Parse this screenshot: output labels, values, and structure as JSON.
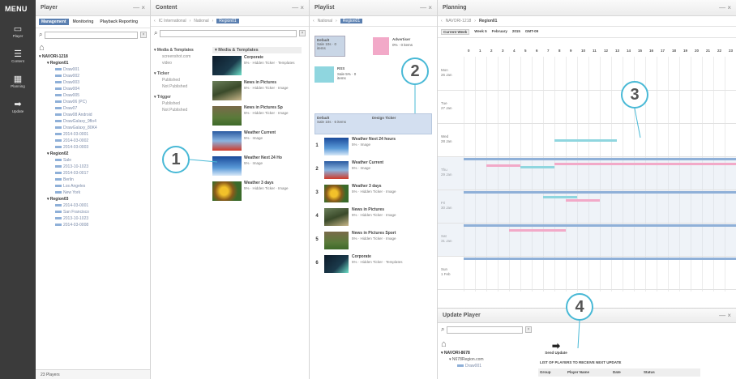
{
  "menu": {
    "title": "MENU",
    "items": [
      {
        "label": "Player",
        "icon": "monitor-icon"
      },
      {
        "label": "Content",
        "icon": "content-icon"
      },
      {
        "label": "Planning",
        "icon": "calendar-icon"
      },
      {
        "label": "Update",
        "icon": "arrow-right-icon"
      }
    ]
  },
  "player_panel": {
    "title": "Player",
    "controls": "— ×",
    "tabs": [
      "Management",
      "Monitoring",
      "Playback Reporting"
    ],
    "search_placeholder": "",
    "tree": {
      "root": "NAVORI-1218",
      "region1": "Region01",
      "region1_items": [
        "Draw001",
        "Draw002",
        "Draw003",
        "Draw004",
        "Draw005",
        "Draw06 (PC)",
        "Draw07",
        "Draw08 Android",
        "DrawGalaxy_9flo4",
        "DrawGalaxy_80K4",
        "2014-03-0001",
        "2014-03-0002",
        "2014-03-0003"
      ],
      "region2": "Region02",
      "region2_items": [
        "Sale",
        "2013-10-1023",
        "2014-03-0017",
        "Berlin",
        "Los Angeles",
        "New York"
      ],
      "region3": "Region03",
      "region3_items": [
        "2014-03-0001",
        "San Francisco",
        "2013-10-1023",
        "2014-03-0008"
      ]
    },
    "footer": "23 Players"
  },
  "content_panel": {
    "title": "Content",
    "controls": "— ×",
    "breadcrumb": [
      "IC International",
      "National",
      "Region01"
    ],
    "tree": {
      "media": "Media & Templates",
      "media_items": [
        "screenshot.com",
        "video"
      ],
      "ticker": "Ticker",
      "ticker_items": [
        "Published",
        "Not Published"
      ],
      "trigger": "Trigger",
      "trigger_items": [
        "Published",
        "Not Published"
      ]
    },
    "list_header": "Media & Templates",
    "items": [
      {
        "title": "Corporate",
        "meta": "5% · Hidden Ticker · Templates"
      },
      {
        "title": "News in Pictures",
        "meta": "5% · Hidden Ticker · Image"
      },
      {
        "title": "News in Pictures Sp",
        "meta": "5% · Hidden Ticker · Image"
      },
      {
        "title": "Weather Current",
        "meta": "5% · Image"
      },
      {
        "title": "Weather Next 24 Ho",
        "meta": "5% · Image"
      },
      {
        "title": "Weather 3 days",
        "meta": "5% · Hidden Ticker · Image"
      }
    ]
  },
  "playlist_panel": {
    "title": "Playlist",
    "controls": "— ×",
    "breadcrumb": [
      "National",
      "Region01"
    ],
    "slots": [
      {
        "label": "Default",
        "meta": "Sale 10s · 0 items"
      },
      {
        "label": "Advertiser",
        "meta": "0% · 0 items"
      },
      {
        "label": "RSS",
        "meta": "Sale 5% · 0 items"
      }
    ],
    "selected": {
      "label": "Default",
      "meta": "Sale 10s · 6 items",
      "extra": "Design Ticker"
    },
    "items": [
      {
        "num": "1",
        "title": "Weather Next 24 hours",
        "meta": "5% · Image"
      },
      {
        "num": "2",
        "title": "Weather Current",
        "meta": "5% · Image"
      },
      {
        "num": "3",
        "title": "Weather 3 days",
        "meta": "5% · Hidden Ticker · Image"
      },
      {
        "num": "4",
        "title": "News in Pictures",
        "meta": "5% · Hidden Ticker · Image"
      },
      {
        "num": "5",
        "title": "News in Pictures Sport",
        "meta": "5% · Hidden Ticker · Image"
      },
      {
        "num": "6",
        "title": "Corporate",
        "meta": "5% · Hidden Ticker · Templates"
      }
    ]
  },
  "planning_panel": {
    "title": "Planning",
    "controls": "— ×",
    "breadcrumb": [
      "NAVORI-1218",
      "Region01"
    ],
    "toolbar": [
      "Current Week",
      "Week 5",
      "February",
      "2015",
      "GMT-09"
    ],
    "hours": [
      "0",
      "1",
      "2",
      "3",
      "4",
      "5",
      "6",
      "7",
      "8",
      "9",
      "10",
      "11",
      "12",
      "13",
      "14",
      "15",
      "16",
      "17",
      "18",
      "19",
      "20",
      "21",
      "22",
      "23"
    ],
    "days": [
      {
        "name": "Mon",
        "date": "26 Jan"
      },
      {
        "name": "Tue",
        "date": "27 Jan"
      },
      {
        "name": "Wed",
        "date": "28 Jan"
      },
      {
        "name": "Thu",
        "date": "29 Jan"
      },
      {
        "name": "Fri",
        "date": "30 Jan"
      },
      {
        "name": "Sat",
        "date": "31 Jan"
      },
      {
        "name": "Sun",
        "date": "1 Feb"
      }
    ]
  },
  "update_panel": {
    "title": "Update Player",
    "controls": "— ×",
    "tree_root": "NAVORI-8678",
    "tree_child": "N678Region.com",
    "tree_leaf": "Draw001",
    "send_label": "Send Update",
    "list_title": "LIST OF PLAYERS TO RECEIVE NEXT UPDATE",
    "columns": [
      "Group",
      "Player Name",
      "Date",
      "Status"
    ]
  },
  "callouts": [
    "1",
    "2",
    "3",
    "4"
  ],
  "colors": {
    "accent": "#49b9d6",
    "menu": "#3b3b3b",
    "blue_bar": "#8fb0d8",
    "pink_bar": "#f2a9c8",
    "teal_bar": "#8fd6df"
  }
}
